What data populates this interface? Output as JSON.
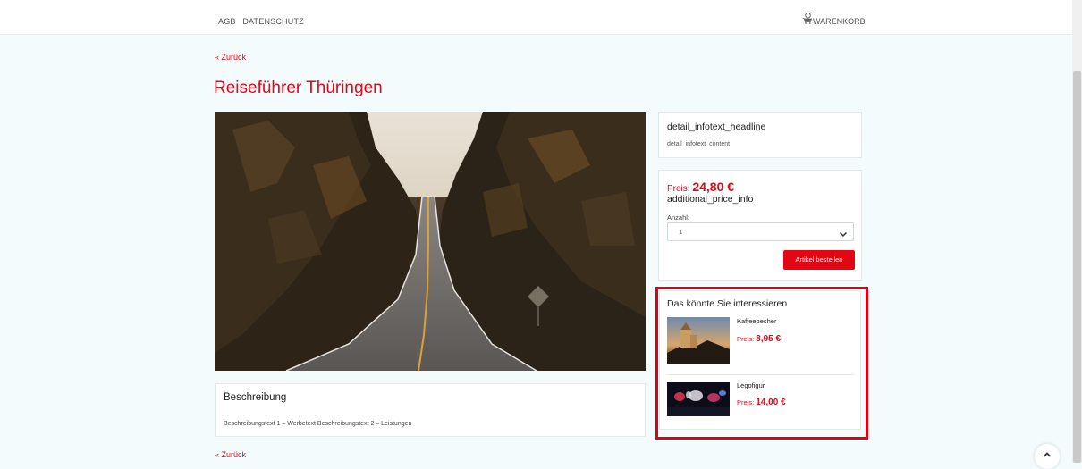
{
  "topnav": {
    "agb": "AGB",
    "datenschutz": "DATENSCHUTZ",
    "cart_label": "WARENKORB"
  },
  "back_link": "« Zurück",
  "title": "Reiseführer Thüringen",
  "description": {
    "heading": "Beschreibung",
    "text": "Beschreibungstext 1 – Werbetext Beschreibungstext 2 – Leistungen"
  },
  "info": {
    "heading": "detail_infotext_headline",
    "content": "detail_infotext_content"
  },
  "price": {
    "label": "Preis:",
    "amount": "24,80 €",
    "additional": "additional_price_info",
    "quantity_label": "Anzahl:",
    "quantity_value": "1",
    "order_button": "Artikel bestellen"
  },
  "recommendations": {
    "heading": "Das könnte Sie interessieren",
    "items": [
      {
        "name": "Kaffeebecher",
        "price_label": "Preis:",
        "price": "8,95 €"
      },
      {
        "name": "Legofigur",
        "price_label": "Preis:",
        "price": "14,00 €"
      }
    ]
  },
  "colors": {
    "accent": "#e30613",
    "background": "#f3fbfd",
    "highlight": "#e1000f"
  },
  "icons": {
    "cart": "cart-icon",
    "select": "chevron-down-icon",
    "totop": "chevron-up-icon"
  }
}
